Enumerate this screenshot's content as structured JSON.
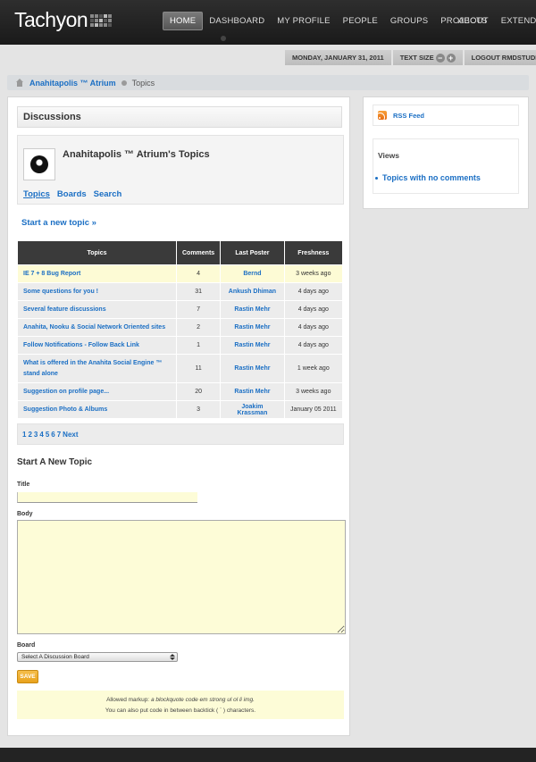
{
  "header": {
    "logo": "Tachyon",
    "nav": [
      "HOME",
      "DASHBOARD",
      "MY PROFILE",
      "PEOPLE",
      "GROUPS",
      "PROJECTS"
    ],
    "nav_right": [
      "ABOUT",
      "EXTEND"
    ]
  },
  "subbar": {
    "date": "MONDAY, JANUARY 31, 2011",
    "text_size": "TEXT SIZE",
    "logout": "LOGOUT RMDSTUDIO"
  },
  "breadcrumb": {
    "group": "Anahitapolis ™ Atrium",
    "current": "Topics"
  },
  "discussions": {
    "heading": "Discussions",
    "group_title": "Anahitapolis ™ Atrium's Topics",
    "tabs": [
      "Topics",
      "Boards",
      "Search"
    ],
    "start_new_topic": "Start a new topic »"
  },
  "table": {
    "headers": [
      "Topics",
      "Comments",
      "Last Poster",
      "Freshness"
    ],
    "rows": [
      {
        "topic": "IE 7 + 8 Bug Report",
        "comments": "4",
        "poster": "Bernd",
        "freshness": "3 weeks ago"
      },
      {
        "topic": "Some questions for you !",
        "comments": "31",
        "poster": "Ankush Dhiman",
        "freshness": "4 days ago"
      },
      {
        "topic": "Several feature discussions",
        "comments": "7",
        "poster": "Rastin Mehr",
        "freshness": "4 days ago"
      },
      {
        "topic": "Anahita, Nooku & Social Network Oriented sites",
        "comments": "2",
        "poster": "Rastin Mehr",
        "freshness": "4 days ago"
      },
      {
        "topic": "Follow Notifications - Follow Back Link",
        "comments": "1",
        "poster": "Rastin Mehr",
        "freshness": "4 days ago"
      },
      {
        "topic": "What is offered in the Anahita Social Engine ™ stand alone",
        "comments": "11",
        "poster": "Rastin Mehr",
        "freshness": "1 week ago"
      },
      {
        "topic": "Suggestion on profile page...",
        "comments": "20",
        "poster": "Rastin Mehr",
        "freshness": "3 weeks ago"
      },
      {
        "topic": "Suggestion Photo & Albums",
        "comments": "3",
        "poster": "Joakim Krassman",
        "freshness": "January 05 2011"
      }
    ]
  },
  "pager": {
    "pages": [
      "1",
      "2",
      "3",
      "4",
      "5",
      "6",
      "7"
    ],
    "next": "Next"
  },
  "form": {
    "heading": "Start A New Topic",
    "title_label": "Title",
    "body_label": "Body",
    "board_label": "Board",
    "board_selected": "Select A Discussion Board",
    "save": "SAVE",
    "markup_prefix": "Allowed markup:",
    "markup_tags": "a blockquote code em strong ul ol li img.",
    "backtick_note": "You can also put code in between backtick ( ` ) characters."
  },
  "sidebar": {
    "rss": "RSS Feed",
    "views_title": "Views",
    "views_item": "Topics with no comments"
  }
}
